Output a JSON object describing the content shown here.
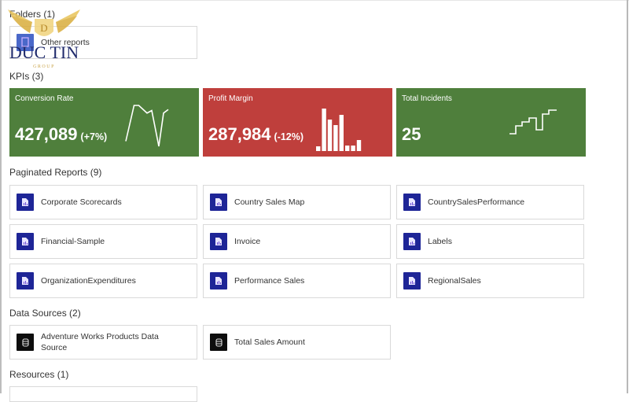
{
  "sections": {
    "folders": "Folders (1)",
    "kpis": "KPIs (3)",
    "paginated": "Paginated Reports (9)",
    "datasources": "Data Sources (2)",
    "resources": "Resources (1)"
  },
  "folders": [
    {
      "label": "Other reports",
      "icon": "folder-icon"
    }
  ],
  "kpis": [
    {
      "title": "Conversion Rate",
      "value": "427,089",
      "delta": "(+7%)",
      "status": "positive",
      "color": "#4f7f3c",
      "visual": "line",
      "sparkline": [
        1,
        8,
        8,
        6.5,
        7,
        0,
        6.5,
        7.2
      ]
    },
    {
      "title": "Profit Margin",
      "value": "287,984",
      "delta": "(-12%)",
      "status": "negative",
      "color": "#bf3f3c",
      "visual": "bar",
      "sparkline": [
        6,
        54,
        40,
        33,
        46,
        7,
        7,
        14
      ]
    },
    {
      "title": "Total Incidents",
      "value": "25",
      "delta": "",
      "status": "positive",
      "color": "#4f7f3c",
      "visual": "step",
      "sparkline": [
        1,
        3,
        4,
        5,
        2,
        6,
        7
      ]
    }
  ],
  "paginated_reports": [
    {
      "label": "Corporate Scorecards"
    },
    {
      "label": "Country Sales Map"
    },
    {
      "label": "CountrySalesPerformance"
    },
    {
      "label": "Financial-Sample"
    },
    {
      "label": "Invoice"
    },
    {
      "label": "Labels"
    },
    {
      "label": "OrganizationExpenditures"
    },
    {
      "label": "Performance Sales"
    },
    {
      "label": "RegionalSales"
    }
  ],
  "data_sources": [
    {
      "label": "Adventure Works Products Data Source"
    },
    {
      "label": "Total Sales Amount"
    }
  ],
  "resources": [
    {
      "label": ""
    }
  ],
  "watermark": {
    "brand": "DUC TIN",
    "sub": "GROUP",
    "monogram": "D"
  },
  "colors": {
    "report_icon": "#1e2597",
    "datasource_icon": "#0d0d0d",
    "folder_icon": "#4a68c9",
    "kpi_green": "#4f7f3c",
    "kpi_red": "#bf3f3c"
  }
}
